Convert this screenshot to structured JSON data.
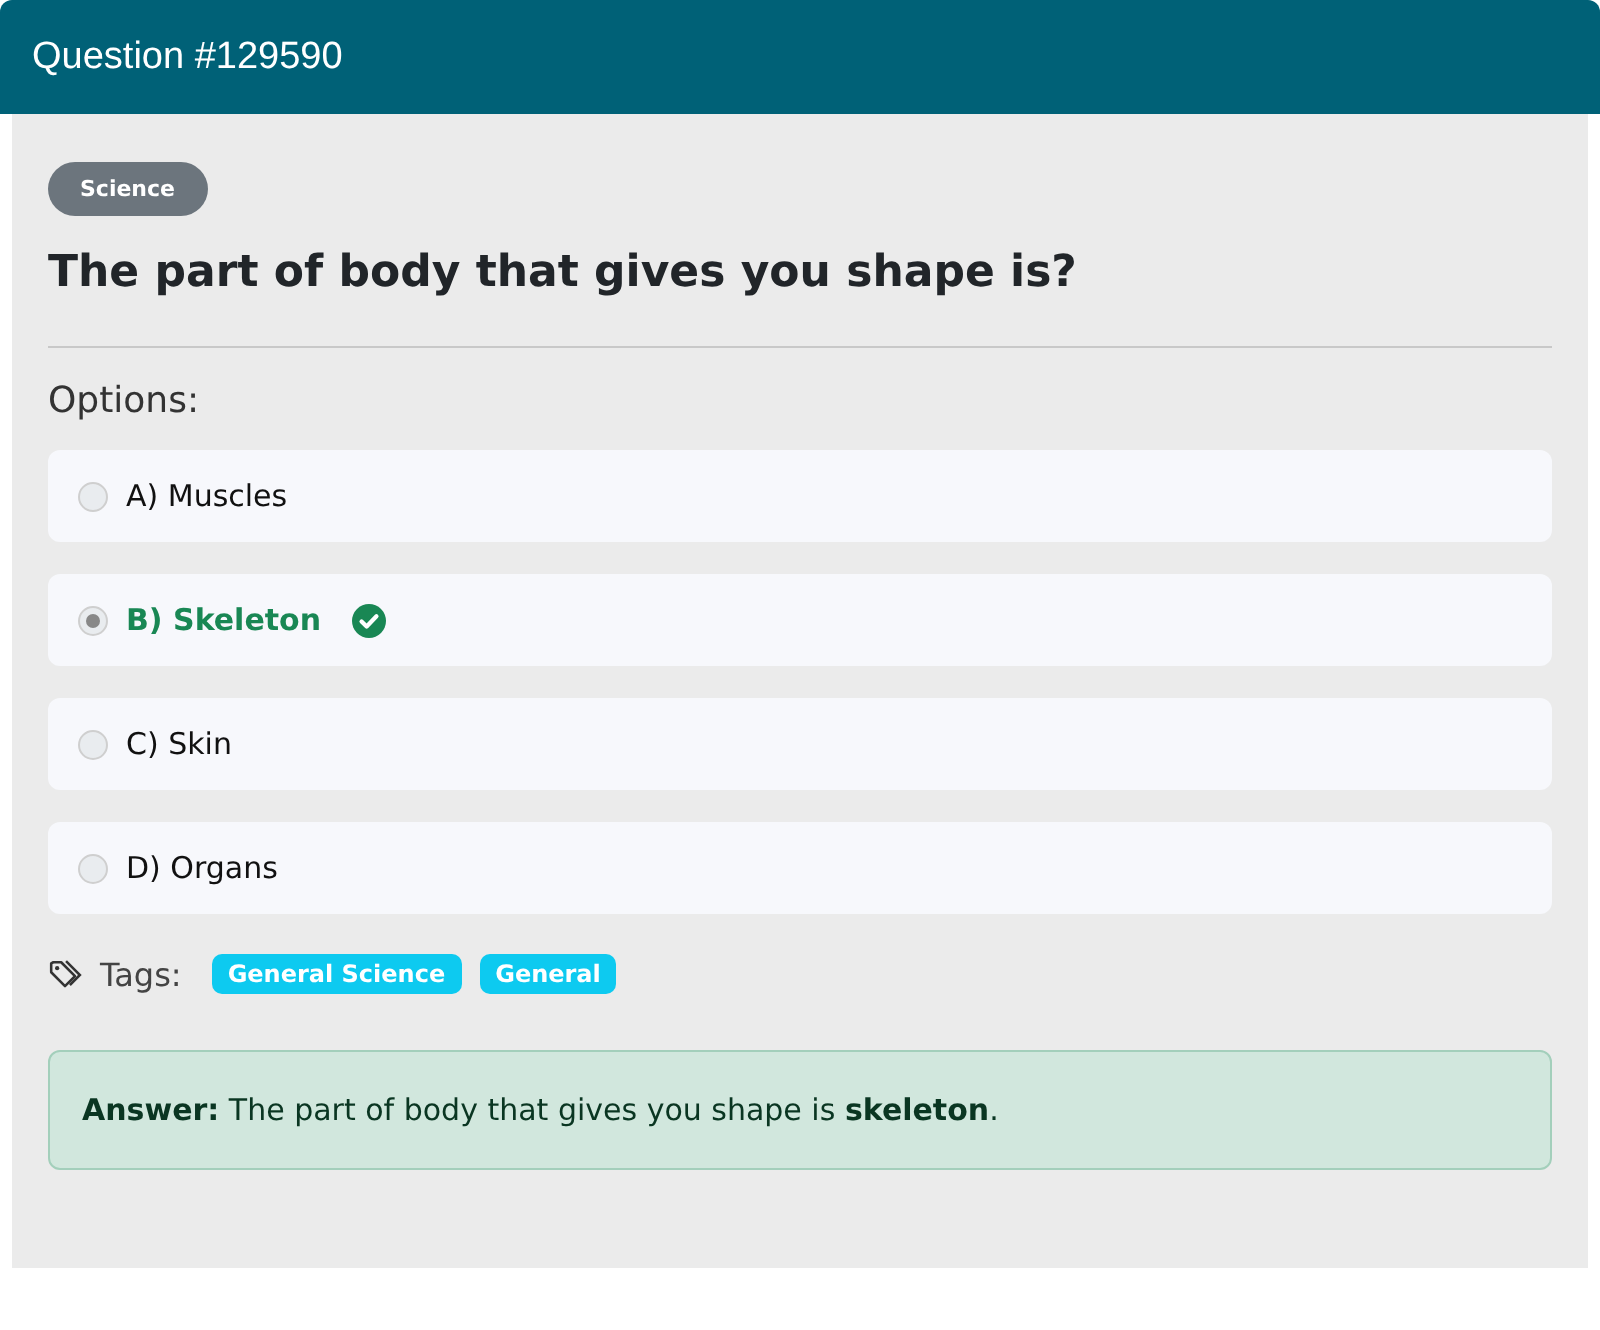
{
  "header": {
    "title": "Question #129590"
  },
  "category": "Science",
  "question": "The part of body that gives you shape is?",
  "options_label": "Options:",
  "options": [
    {
      "label": "A) Muscles",
      "selected": false,
      "correct": false
    },
    {
      "label": "B) Skeleton",
      "selected": true,
      "correct": true
    },
    {
      "label": "C) Skin",
      "selected": false,
      "correct": false
    },
    {
      "label": "D) Organs",
      "selected": false,
      "correct": false
    }
  ],
  "tags_label": "Tags:",
  "tags": [
    "General Science",
    "General"
  ],
  "answer": "**Answer:** The part of body that gives you shape is **skeleton**."
}
